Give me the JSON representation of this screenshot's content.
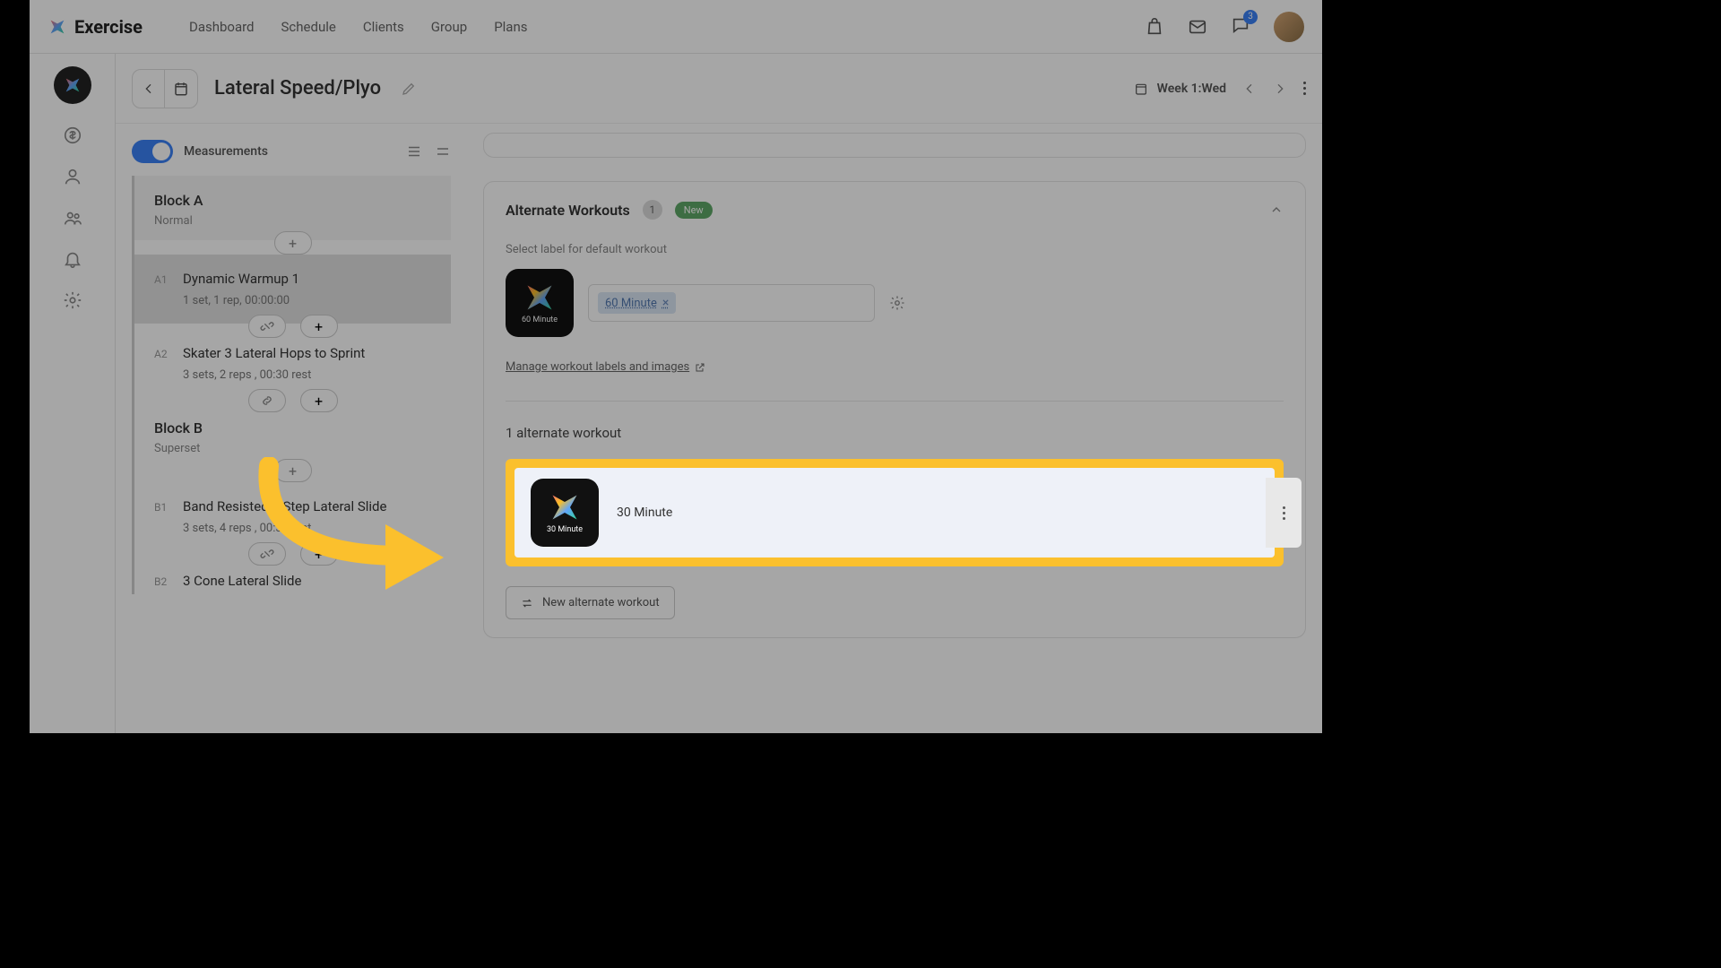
{
  "header": {
    "brand": "Exercise",
    "nav": [
      "Dashboard",
      "Schedule",
      "Clients",
      "Group",
      "Plans"
    ],
    "notif_count": "3"
  },
  "subheader": {
    "title": "Lateral Speed/Plyo",
    "week_label": "Week 1:Wed"
  },
  "sidebar": {
    "measurements_label": "Measurements"
  },
  "blocks": [
    {
      "title": "Block A",
      "subtitle": "Normal",
      "exercises": [
        {
          "code": "A1",
          "name": "Dynamic Warmup 1",
          "detail": "1 set, 1 rep, 00:00:00",
          "selected": true
        },
        {
          "code": "A2",
          "name": "Skater 3 Lateral Hops to Sprint",
          "detail": "3 sets, 2 reps , 00:30 rest",
          "selected": false
        }
      ]
    },
    {
      "title": "Block B",
      "subtitle": "Superset",
      "exercises": [
        {
          "code": "B1",
          "name": "Band Resisted 2 Step Lateral Slide",
          "detail": "3 sets, 4 reps , 00:30 rest",
          "selected": false
        },
        {
          "code": "B2",
          "name": "3 Cone Lateral Slide",
          "detail": "",
          "selected": false
        }
      ]
    }
  ],
  "alternate": {
    "title": "Alternate Workouts",
    "count_badge": "1",
    "new_label": "New",
    "select_label_text": "Select label for default workout",
    "default_chip_text": "60 Minute",
    "default_thumb_caption": "60 Minute",
    "manage_link_text": "Manage workout labels and images",
    "list_heading": "1 alternate workout",
    "item_name": "30 Minute",
    "item_thumb_caption": "30 Minute",
    "new_button": "New alternate workout"
  }
}
